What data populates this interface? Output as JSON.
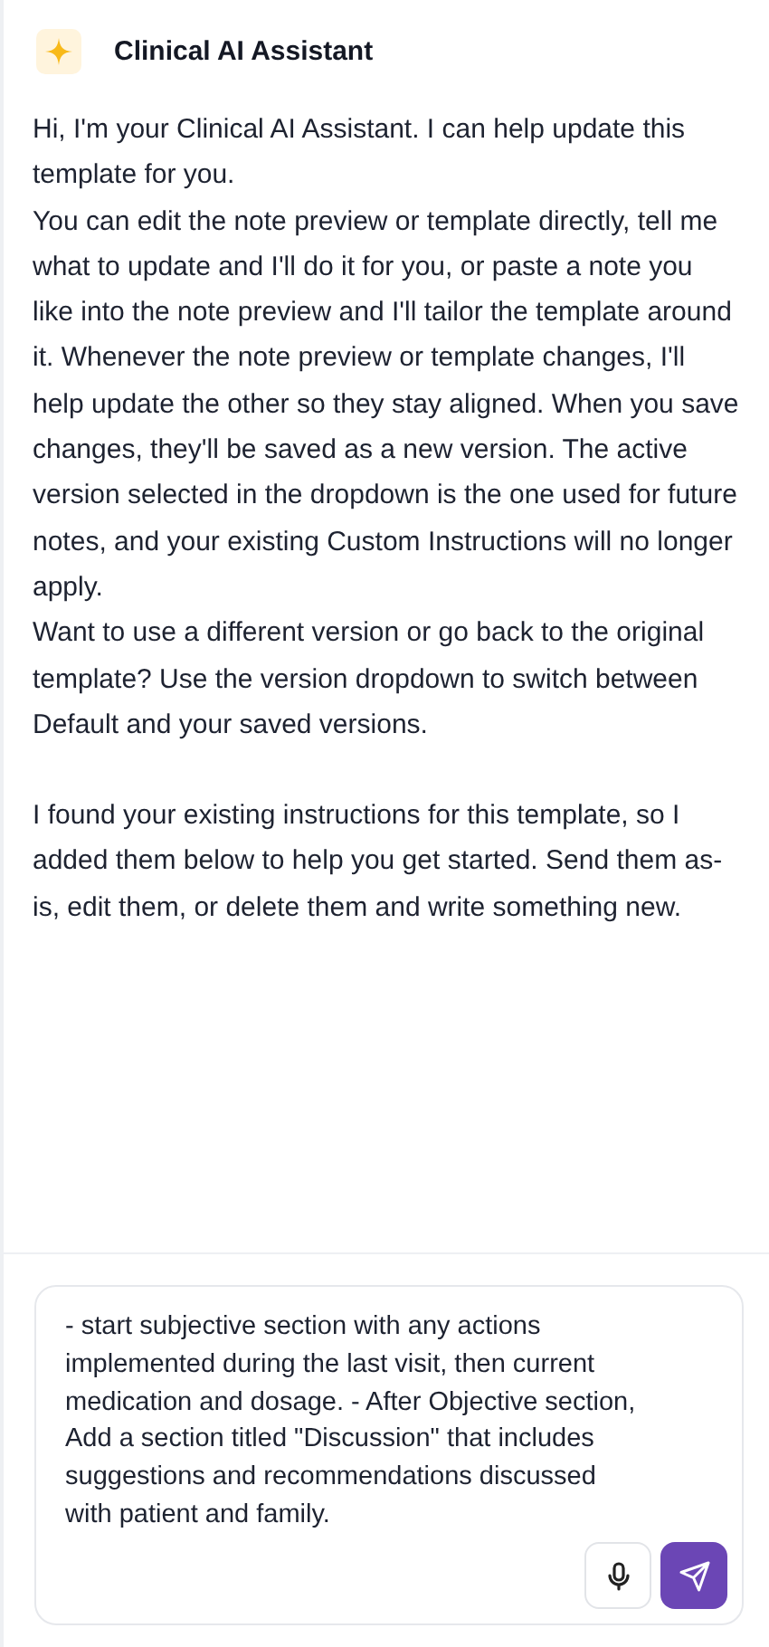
{
  "header": {
    "title": "Clinical AI Assistant"
  },
  "message": {
    "blocks": [
      {
        "paragraphs": [
          "Hi, I'm your Clinical AI Assistant. I can help update this template for you.",
          "You can edit the note preview or template directly, tell me what to update and I'll do it for you, or paste a note you like into the note preview and I'll tailor the template around it. Whenever the note preview or template changes, I'll help update the other so they stay aligned. When you save changes, they'll be saved as a new version. The active version selected in the dropdown is the one used for future notes, and your existing Custom Instructions will no longer apply.",
          "Want to use a different version or go back to the original template? Use the version dropdown to switch between Default and your saved versions."
        ]
      },
      {
        "paragraphs": [
          "I found your existing instructions for this template, so I added them below to help you get started. Send them as-is, edit them, or delete them and write something new."
        ]
      }
    ]
  },
  "composer": {
    "value": "- start subjective section with any actions implemented during the last visit, then current medication and dosage. - After Objective section, Add a section titled \"Discussion\" that includes suggestions and recommendations discussed with patient and family."
  }
}
